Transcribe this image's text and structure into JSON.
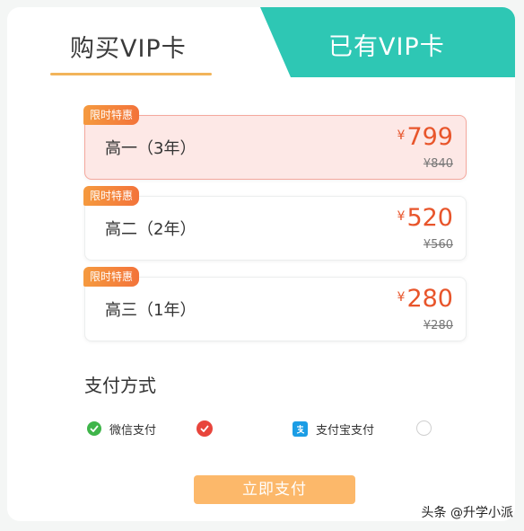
{
  "tabs": {
    "buy_label": "购买VIP卡",
    "owned_label": "已有VIP卡"
  },
  "plans": [
    {
      "badge": "限时特惠",
      "name": "高一（3年）",
      "currency": "¥",
      "price": "799",
      "original": "¥840",
      "selected": true
    },
    {
      "badge": "限时特惠",
      "name": "高二（2年）",
      "currency": "¥",
      "price": "520",
      "original": "¥560",
      "selected": false
    },
    {
      "badge": "限时特惠",
      "name": "高三（1年）",
      "currency": "¥",
      "price": "280",
      "original": "¥280",
      "selected": false
    }
  ],
  "payment": {
    "title": "支付方式",
    "options": [
      {
        "label": "微信支付",
        "icon": "wechat-icon",
        "selected": true
      },
      {
        "label": "支付宝支付",
        "icon": "alipay-icon",
        "selected": false
      }
    ],
    "submit_label": "立即支付"
  },
  "watermark": "头条 @升学小派",
  "colors": {
    "accent_teal": "#2ec7b4",
    "price_red": "#e8552b",
    "badge_orange": "#f3733a",
    "button_orange": "#fcb86a",
    "tab_underline": "#f2b45a"
  }
}
